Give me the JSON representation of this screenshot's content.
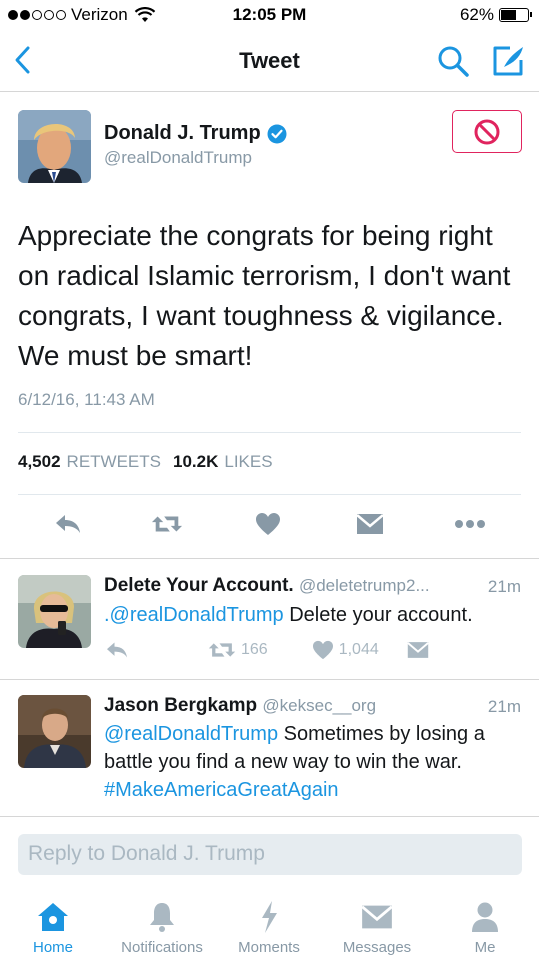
{
  "status_bar": {
    "carrier": "Verizon",
    "time": "12:05 PM",
    "battery": "62%",
    "battery_level": 0.62
  },
  "nav": {
    "title": "Tweet",
    "back_icon": "chevron-left-icon",
    "search_icon": "search-icon",
    "compose_icon": "compose-icon",
    "accent": "#1b95e0"
  },
  "main_tweet": {
    "author_name": "Donald J. Trump",
    "verified": true,
    "handle": "@realDonaldTrump",
    "text": "Appreciate the congrats for being right on radical Islamic terrorism, I don't want congrats, I want toughness & vigilance. We must be smart!",
    "timestamp": "6/12/16, 11:43 AM",
    "retweets_count": "4,502",
    "retweets_label": "RETWEETS",
    "likes_count": "10.2K",
    "likes_label": "LIKES",
    "block_icon": "block-icon"
  },
  "replies": [
    {
      "name": "Delete Your Account.",
      "handle": "@deletetrump2...",
      "time": "21m",
      "mention": ".@realDonaldTrump",
      "text": " Delete your account.",
      "retweets": "166",
      "likes": "1,044"
    },
    {
      "name": "Jason Bergkamp",
      "handle": "@keksec__org",
      "time": "21m",
      "mention": "@realDonaldTrump",
      "text": " Sometimes by losing a battle you find a new way to win the war. ",
      "hashtag": "#MakeAmericaGreatAgain"
    }
  ],
  "reply_box": {
    "placeholder": "Reply to Donald J. Trump"
  },
  "tab_bar": [
    {
      "label": "Home",
      "icon": "home-icon",
      "active": true
    },
    {
      "label": "Notifications",
      "icon": "bell-icon",
      "active": false
    },
    {
      "label": "Moments",
      "icon": "lightning-icon",
      "active": false
    },
    {
      "label": "Messages",
      "icon": "envelope-icon",
      "active": false
    },
    {
      "label": "Me",
      "icon": "person-icon",
      "active": false
    }
  ]
}
